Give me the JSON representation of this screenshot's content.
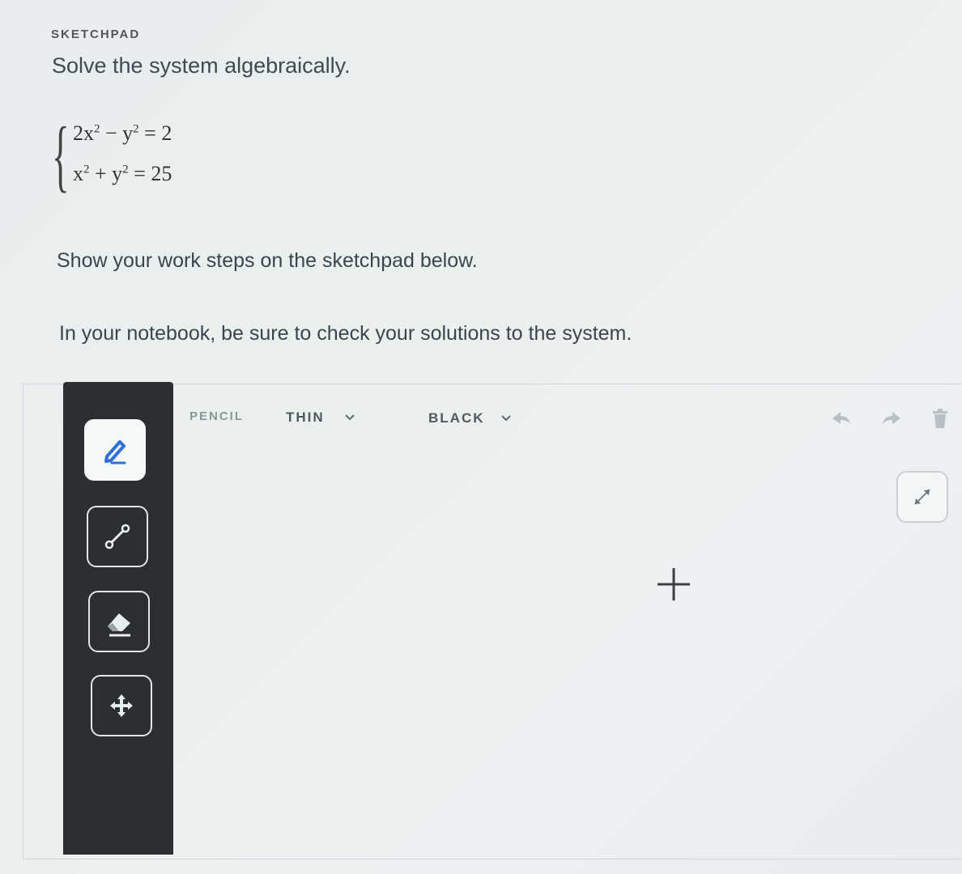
{
  "header": {
    "section_label": "SKETCHPAD",
    "prompt": "Solve the system algebraically."
  },
  "system": {
    "eq1": {
      "a": "2x",
      "exp1": "2",
      "op": " − y",
      "exp2": "2",
      "rhs": " = 2"
    },
    "eq2": {
      "a": "x",
      "exp1": "2",
      "op": " + y",
      "exp2": "2",
      "rhs": " = 25"
    }
  },
  "instructions": {
    "line1": "Show your work steps on the sketchpad below.",
    "line2": "In your notebook, be sure to check your solutions to the system."
  },
  "sketchpad": {
    "toolbar": {
      "tool_label": "PENCIL",
      "thickness_label": "THIN",
      "color_label": "BLACK"
    },
    "tools": [
      {
        "icon": "pencil-icon",
        "active": true
      },
      {
        "icon": "line-icon",
        "active": false
      },
      {
        "icon": "eraser-icon",
        "active": false
      },
      {
        "icon": "move-icon",
        "active": false
      }
    ],
    "accent_color": "#2f6fd6"
  }
}
